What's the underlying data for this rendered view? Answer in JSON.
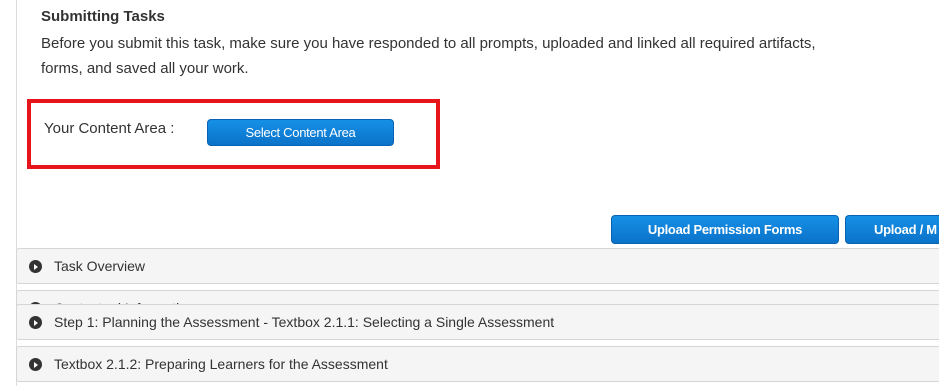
{
  "section": {
    "title": "Submitting Tasks",
    "description_line1": "Before you submit this task, make sure you have responded to all prompts, uploaded and linked all required artifacts,",
    "description_line2": "forms, and saved all your work."
  },
  "content_area": {
    "label": "Your Content Area :",
    "button_label": "Select Content Area",
    "highlight_color": "#e8141c"
  },
  "toolbar": {
    "upload_permission_label": "Upload Permission Forms",
    "upload_label": "Upload / M"
  },
  "accordion": [
    {
      "label": "Task Overview",
      "icon": "chevron-right-circle-icon"
    },
    {
      "label": "Contextual Information",
      "icon": "chevron-right-circle-icon"
    },
    {
      "label": "Step 1: Planning the Assessment - Textbox 2.1.1: Selecting a Single Assessment",
      "icon": "chevron-right-circle-icon"
    },
    {
      "label": "Textbox 2.1.2: Preparing Learners for the Assessment",
      "icon": "chevron-right-circle-icon"
    }
  ],
  "colors": {
    "button_blue": "#1590e6",
    "accordion_bg": "#f5f5f5",
    "text": "#333333"
  }
}
